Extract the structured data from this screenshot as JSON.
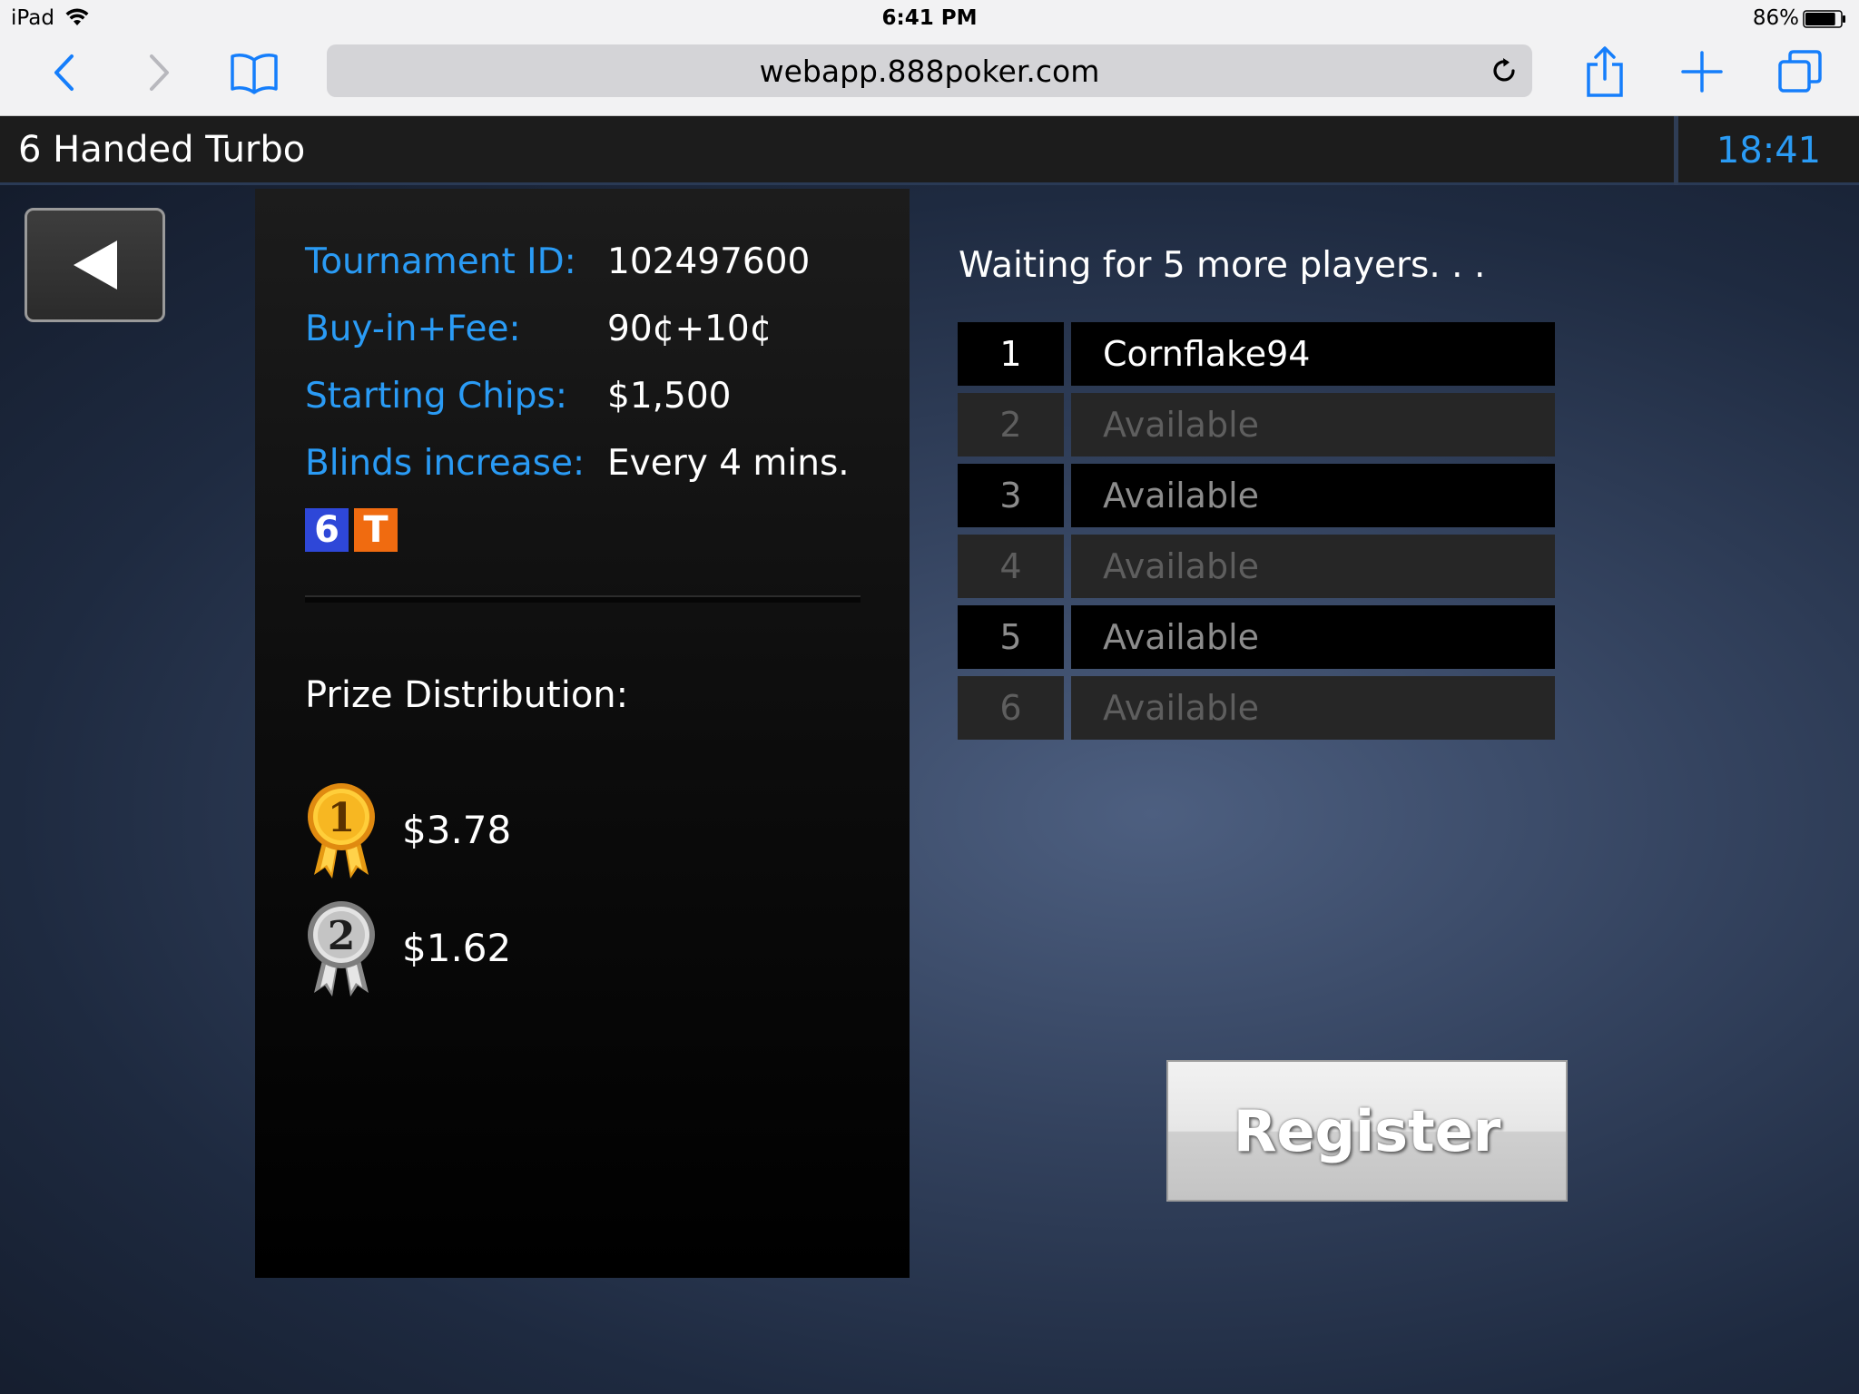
{
  "status_bar": {
    "device": "iPad",
    "time": "6:41 PM",
    "battery": "86%",
    "battery_level": 0.86
  },
  "browser": {
    "url": "webapp.888poker.com",
    "icons": [
      "back-icon",
      "forward-icon",
      "bookmarks-icon",
      "reload-icon",
      "share-icon",
      "add-icon",
      "tabs-icon"
    ]
  },
  "header": {
    "title": "6 Handed Turbo",
    "clock": "18:41"
  },
  "tournament": {
    "rows": [
      {
        "label": "Tournament ID:",
        "value": "102497600"
      },
      {
        "label": "Buy-in+Fee:",
        "value": "90¢+10¢"
      },
      {
        "label": "Starting Chips:",
        "value": "$1,500"
      },
      {
        "label": "Blinds increase:",
        "value": "Every 4 mins."
      }
    ],
    "badges": {
      "six": "6",
      "turbo": "T"
    },
    "colors": {
      "label": "#2a9bf5",
      "badge_six": "#2e47d8",
      "badge_turbo": "#f06b10"
    }
  },
  "prizes": {
    "title": "Prize Distribution:",
    "items": [
      {
        "place": "1",
        "amount": "$3.78",
        "medal": "gold-medal-icon"
      },
      {
        "place": "2",
        "amount": "$1.62",
        "medal": "silver-medal-icon"
      }
    ]
  },
  "seats": {
    "waiting": "Waiting for 5 more players. . .",
    "rows": [
      {
        "num": "1",
        "name": "Cornflake94"
      },
      {
        "num": "2",
        "name": "Available"
      },
      {
        "num": "3",
        "name": "Available"
      },
      {
        "num": "4",
        "name": "Available"
      },
      {
        "num": "5",
        "name": "Available"
      },
      {
        "num": "6",
        "name": "Available"
      }
    ]
  },
  "register": {
    "label": "Register"
  }
}
